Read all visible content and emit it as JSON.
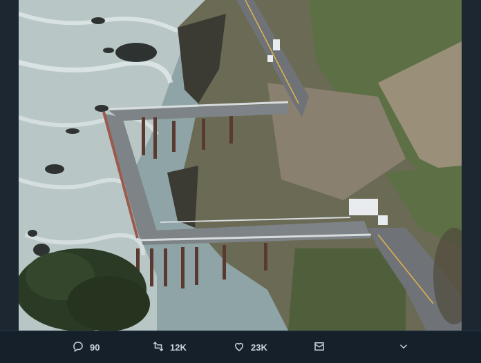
{
  "photo": {
    "alt_icon": "photo-image"
  },
  "actions": {
    "reply": {
      "icon": "reply-icon",
      "count": "90"
    },
    "retweet": {
      "icon": "retweet-icon",
      "count": "12K"
    },
    "like": {
      "icon": "heart-icon",
      "count": "23K"
    },
    "dm": {
      "icon": "envelope-icon"
    },
    "more": {
      "icon": "chevron-down-icon"
    }
  },
  "colors": {
    "background": "#15202b",
    "icon": "#c9d3dc"
  }
}
